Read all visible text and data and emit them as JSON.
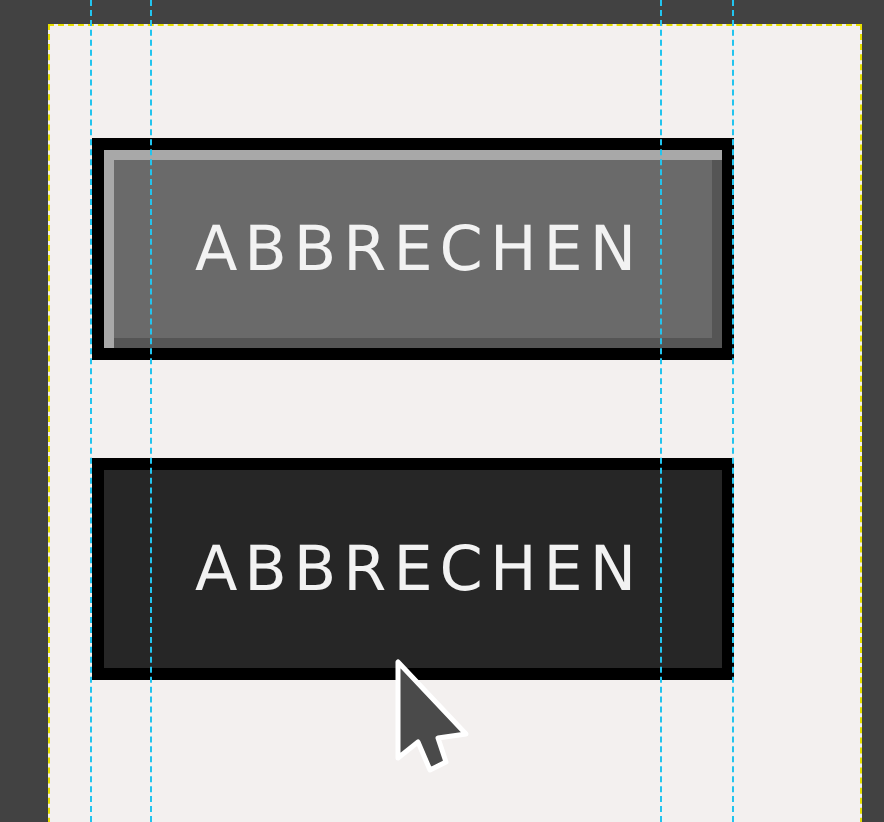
{
  "buttons": [
    {
      "label": "ABBRECHEN",
      "kind": "raised"
    },
    {
      "label": "ABBRECHEN",
      "kind": "pressed"
    }
  ]
}
